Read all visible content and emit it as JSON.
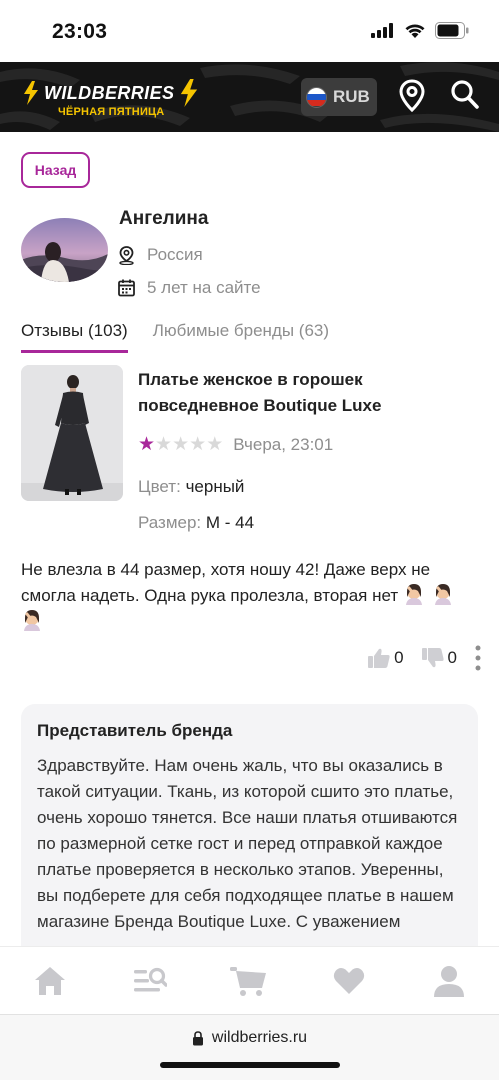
{
  "status_bar": {
    "time": "23:03"
  },
  "header": {
    "logo_title": "WILDBERRIES",
    "logo_subtitle": "ЧЁРНАЯ ПЯТНИЦА",
    "currency": "RUB",
    "colors": {
      "background": "#141414",
      "accent": "#f5c400"
    }
  },
  "back_label": "Назад",
  "profile": {
    "name": "Ангелина",
    "country": "Россия",
    "membership": "5 лет на сайте"
  },
  "tabs": [
    {
      "label": "Отзывы (103)",
      "active": true
    },
    {
      "label": "Любимые бренды (63)",
      "active": false
    }
  ],
  "review": {
    "product_title": "Платье женское в горошек повседневное Boutique Luxe",
    "rating": 1,
    "rating_max": 5,
    "date": "Вчера, 23:01",
    "color_label": "Цвет:",
    "color_value": "черный",
    "size_label": "Размер:",
    "size_value": "M - 44",
    "text": "Не влезла в 44 размер, хотя ношу 42! Даже верх не смогла надеть. Одна рука пролезла, вторая нет",
    "likes": "0",
    "dislikes": "0"
  },
  "brand_reply": {
    "title": "Представитель бренда",
    "text": "Здравствуйте. Нам очень жаль, что вы оказались в такой ситуации. Ткань, из которой сшито это платье, очень хорошо тянется. Все наши платья отшиваются по размерной сетке гост и перед отправкой каждое платье проверяется в несколько этапов. Уверенны, вы подберете для себя подходящее платье в нашем магазине Бренда Boutique Luxe. С уважением"
  },
  "bottom_nav": [
    {
      "icon": "home-icon"
    },
    {
      "icon": "catalog-search-icon"
    },
    {
      "icon": "cart-icon"
    },
    {
      "icon": "heart-icon"
    },
    {
      "icon": "profile-icon"
    }
  ],
  "url_bar": {
    "domain": "wildberries.ru"
  },
  "colors": {
    "accent": "#a8279a",
    "star_filled": "#a8279a",
    "star_empty": "#d9d9d9",
    "muted_text": "#8e8e8e"
  }
}
